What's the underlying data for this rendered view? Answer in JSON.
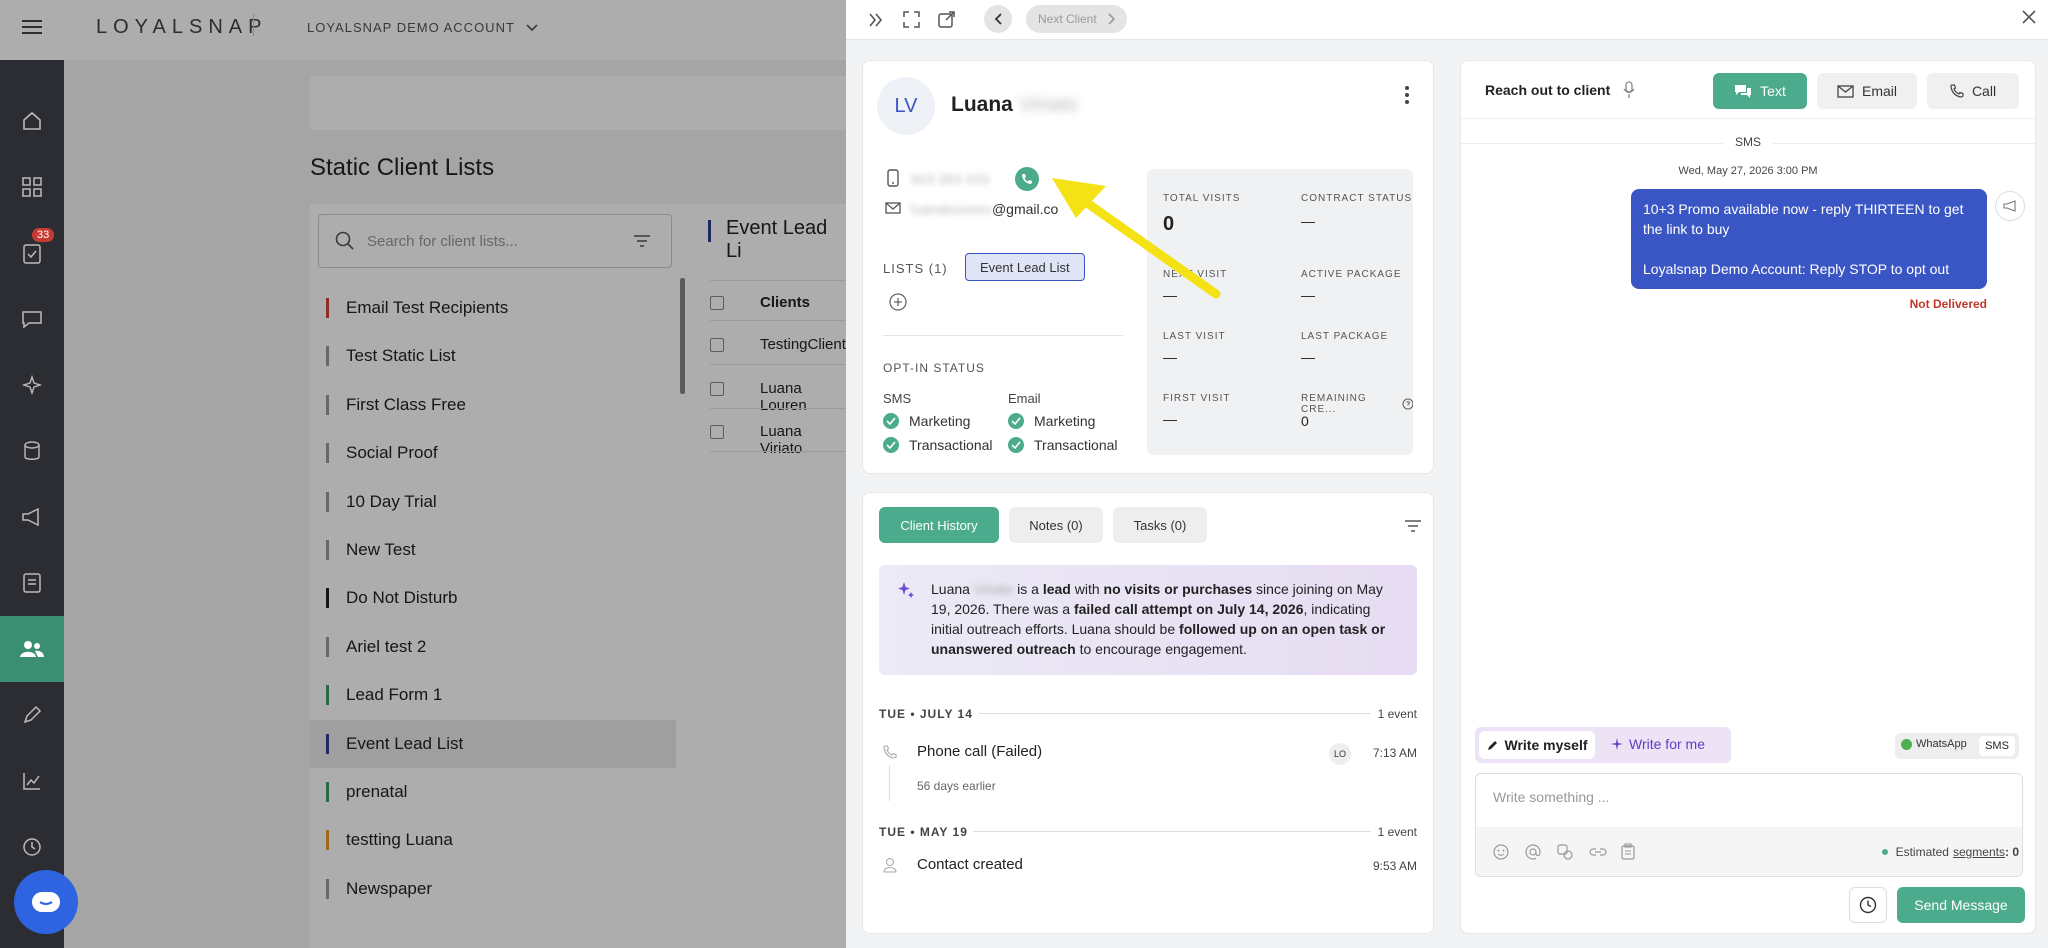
{
  "app": {
    "brand": "LOYALSNAP",
    "account": "LOYALSNAP DEMO ACCOUNT"
  },
  "sidebar": {
    "badge_count": "33"
  },
  "lists_page": {
    "title": "Static Client Lists",
    "search_placeholder": "Search for client lists...",
    "lists": [
      {
        "name": "Email Test Recipients",
        "color": "#d0433a"
      },
      {
        "name": "Test Static List",
        "color": "#9a9a9a"
      },
      {
        "name": "First Class Free",
        "color": "#9a9a9a"
      },
      {
        "name": "Social Proof",
        "color": "#9a9a9a"
      },
      {
        "name": "10 Day Trial",
        "color": "#9a9a9a"
      },
      {
        "name": "New Test",
        "color": "#9a9a9a"
      },
      {
        "name": "Do Not Disturb",
        "color": "#222222"
      },
      {
        "name": "Ariel test 2",
        "color": "#9a9a9a"
      },
      {
        "name": "Lead Form 1",
        "color": "#3a9a6a"
      },
      {
        "name": "Event Lead List",
        "color": "#2a3f8f"
      },
      {
        "name": "prenatal",
        "color": "#3a9a6a"
      },
      {
        "name": "testting Luana",
        "color": "#e59a2a"
      },
      {
        "name": "Newspaper",
        "color": "#9a9a9a"
      }
    ],
    "detail_title": "Event Lead Li",
    "clients_header": "Clients",
    "clients": [
      "TestingClient",
      "Luana Louren",
      "Luana Viriato"
    ]
  },
  "drawer": {
    "next_client": "Next Client",
    "client": {
      "initials": "LV",
      "first_name": "Luana",
      "last_name": "Viriato",
      "phone": "923 383 433",
      "email_user": "luanaloureiro",
      "email_domain": "@gmail.co"
    },
    "lists_label": "LISTS (1)",
    "list_chip": "Event Lead List",
    "optin": {
      "title": "OPT-IN STATUS",
      "sms_label": "SMS",
      "email_label": "Email",
      "marketing": "Marketing",
      "transactional": "Transactional"
    },
    "stats": {
      "total_visits_label": "TOTAL VISITS",
      "total_visits": "0",
      "contract_status_label": "CONTRACT STATUS",
      "contract_status": "—",
      "next_visit_label": "NEXT VISIT",
      "next_visit": "—",
      "active_package_label": "ACTIVE PACKAGE",
      "active_package": "—",
      "last_visit_label": "LAST VISIT",
      "last_visit": "—",
      "last_package_label": "LAST PACKAGE",
      "last_package": "—",
      "first_visit_label": "FIRST VISIT",
      "first_visit": "—",
      "remaining_label": "REMAINING CRE...",
      "remaining": "0"
    },
    "tabs": {
      "history": "Client History",
      "notes": "Notes (0)",
      "tasks": "Tasks (0)"
    },
    "summary": {
      "p1": "Luana",
      "p2": "Viriato",
      "p3": " is a ",
      "p4": "lead",
      "p5": " with ",
      "p6": "no visits or purchases",
      "p7": " since joining on May 19, 2026. There was a ",
      "p8": "failed call attempt on July 14, 2026",
      "p9": ", indicating initial outreach efforts. Luana should be ",
      "p10": "followed up on an open task or unanswered outreach",
      "p11": " to encourage engagement."
    },
    "history": [
      {
        "date": "TUE • JULY 14",
        "count": "1 event",
        "title": "Phone call (Failed)",
        "avatar": "LO",
        "time": "7:13 AM",
        "sub": "56 days earlier"
      },
      {
        "date": "TUE • MAY 19",
        "count": "1 event",
        "title": "Contact created",
        "time": "9:53 AM"
      }
    ],
    "reach": {
      "title": "Reach out to client",
      "text_btn": "Text",
      "email_btn": "Email",
      "call_btn": "Call",
      "channel": "SMS",
      "timestamp": "Wed, May 27, 2026 3:00 PM",
      "message_line1": "10+3 Promo available now - reply THIRTEEN to get the link to buy",
      "message_line2": "Loyalsnap Demo Account: Reply STOP to opt out",
      "status": "Not Delivered",
      "write_myself": "Write myself",
      "write_for_me": "Write for me",
      "whatsapp": "WhatsApp",
      "sms": "SMS",
      "placeholder": "Write something ...",
      "segments_prefix": "Estimated ",
      "segments_link": "segments",
      "segments_value": ": 0",
      "send": "Send Message"
    }
  },
  "colors": {
    "accent": "#4cab8c",
    "bubble": "#3a56c4",
    "arrow": "#f5e214",
    "dark_sidebar": "#2c2d33"
  }
}
